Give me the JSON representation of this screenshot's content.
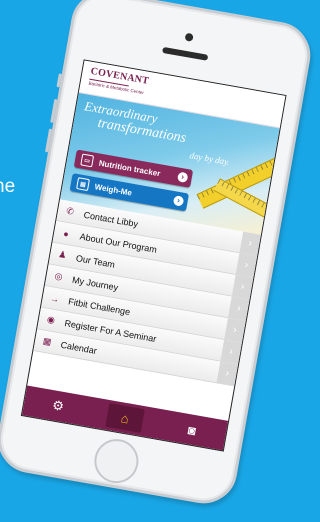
{
  "background": {
    "color": "#19a6e6",
    "partial_text": "ne"
  },
  "app": {
    "logo": "COVENANT",
    "logo_subtitle": "Bariatric & Metabolic Center",
    "brand_color": "#7a2050"
  },
  "banner": {
    "line1": "Extraordinary",
    "line2": "transformations",
    "line3": "day by day.",
    "buttons": [
      {
        "label": "Nutrition tracker",
        "color": "#8a2a5c"
      },
      {
        "label": "Weigh-Me",
        "color": "#1576c4"
      }
    ]
  },
  "menu": {
    "items": [
      {
        "label": "Contact Libby",
        "icon": "phone-icon"
      },
      {
        "label": "About Our Program",
        "icon": "info-icon"
      },
      {
        "label": "Our Team",
        "icon": "team-icon"
      },
      {
        "label": "My Journey",
        "icon": "journey-icon"
      },
      {
        "label": "Fitbit Challenge",
        "icon": "fitbit-icon"
      },
      {
        "label": "Register For A Seminar",
        "icon": "seminar-icon"
      },
      {
        "label": "Calendar",
        "icon": "calendar-icon"
      }
    ]
  },
  "footer": {
    "buttons": [
      {
        "name": "settings",
        "icon": "gear-icon"
      },
      {
        "name": "home",
        "icon": "home-icon",
        "active": true
      },
      {
        "name": "camera",
        "icon": "camera-icon"
      }
    ]
  }
}
